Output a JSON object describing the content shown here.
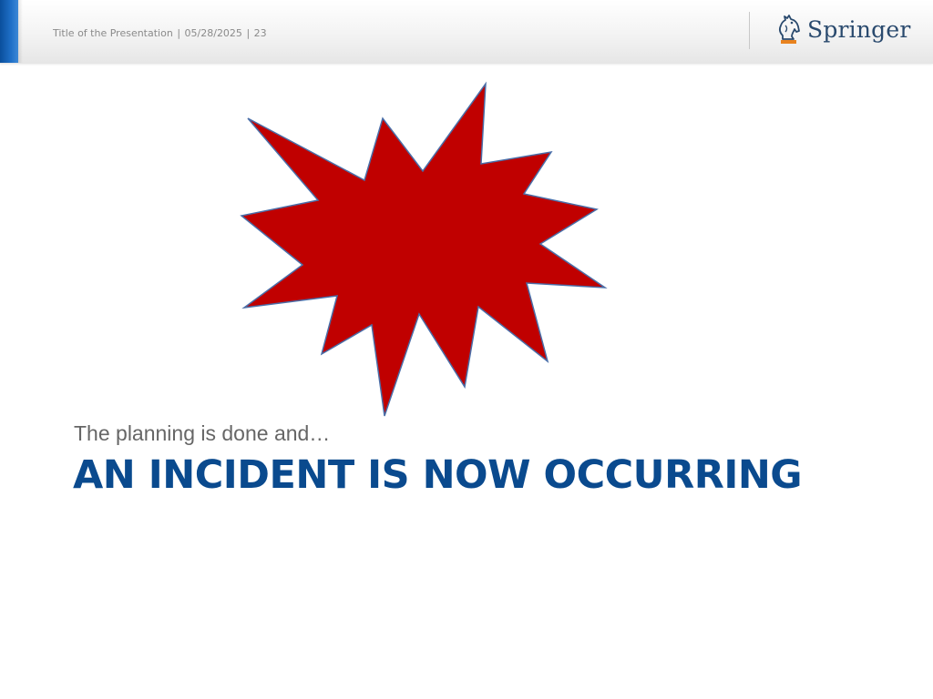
{
  "header": {
    "presentation_title": "Title of the Presentation",
    "separator": "|",
    "date": "05/28/2025",
    "page_number": "23",
    "logo_text": "Springer",
    "accent_color": "#1f6fc7"
  },
  "slide": {
    "subtitle": "The planning is done and…",
    "title": "AN INCIDENT IS NOW OCCURRING",
    "title_color": "#0a4a8e",
    "graphic": "explosion-starburst",
    "graphic_fill": "#c00000",
    "graphic_stroke": "#4a6ea8"
  }
}
